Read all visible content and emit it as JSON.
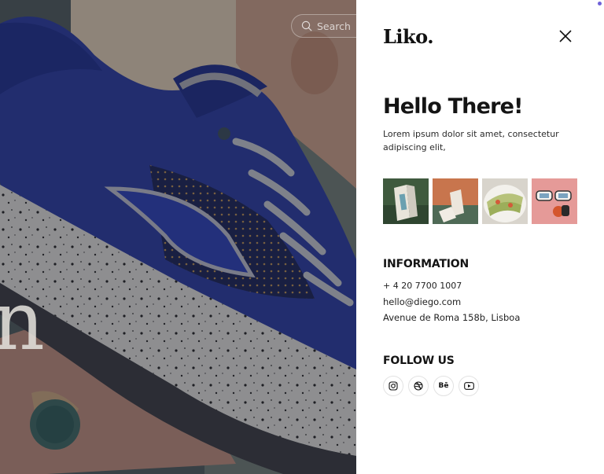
{
  "hero": {
    "partial_title": "n",
    "search": {
      "label": "Search",
      "icon": "search-icon"
    }
  },
  "panel": {
    "logo": "Liko.",
    "close_icon": "close-icon",
    "heading": "Hello There!",
    "intro": "Lorem ipsum dolor sit amet, consectetur adipiscing elit,",
    "gallery": [
      {
        "icon": "book-photo"
      },
      {
        "icon": "cards-photo"
      },
      {
        "icon": "food-plate-photo"
      },
      {
        "icon": "sunglasses-photo"
      }
    ],
    "information": {
      "title": "INFORMATION",
      "phone": "+ 4 20 7700 1007",
      "email": "hello@diego.com",
      "address": "Avenue de Roma 158b, Lisboa"
    },
    "follow": {
      "title": "FOLLOW US",
      "socials": [
        {
          "icon": "instagram-icon"
        },
        {
          "icon": "dribbble-icon"
        },
        {
          "icon": "behance-icon",
          "label": "Bē"
        },
        {
          "icon": "youtube-icon"
        }
      ]
    }
  },
  "colors": {
    "accent_dot": "#6f62d8",
    "text_dark": "#141414",
    "overlay": "#161826"
  }
}
